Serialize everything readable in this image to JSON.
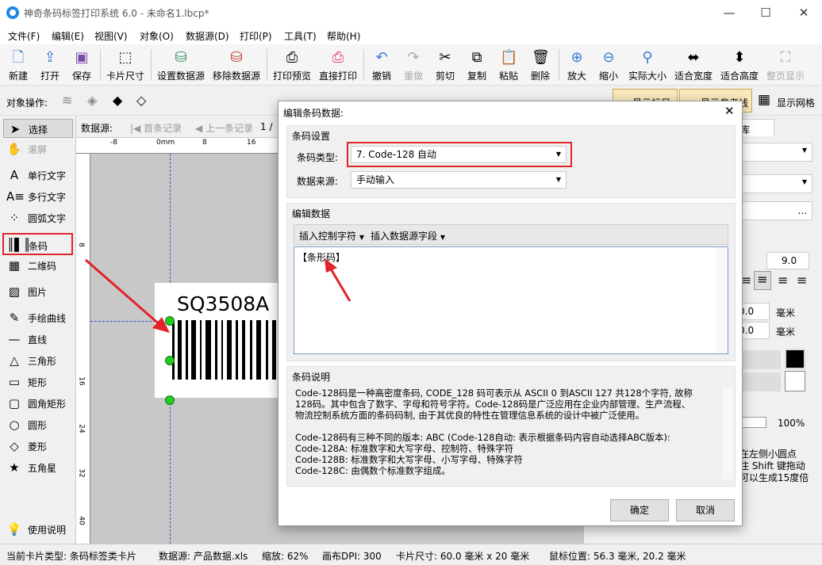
{
  "window": {
    "title": "神奇条码标签打印系统 6.0 - 未命名1.lbcp*",
    "min": "—",
    "max": "☐",
    "close": "✕"
  },
  "menu": [
    "文件(F)",
    "编辑(E)",
    "视图(V)",
    "对象(O)",
    "数据源(D)",
    "打印(P)",
    "工具(T)",
    "帮助(H)"
  ],
  "toolbar": {
    "new": "新建",
    "open": "打开",
    "save": "保存",
    "card_size": "卡片尺寸",
    "set_ds": "设置数据源",
    "remove_ds": "移除数据源",
    "preview": "打印预览",
    "print": "直接打印",
    "undo": "撤销",
    "redo": "重做",
    "cut": "剪切",
    "copy": "复制",
    "paste": "粘贴",
    "delete": "删除",
    "zoom_in": "放大",
    "zoom_out": "缩小",
    "actual": "实际大小",
    "fit_w": "适合宽度",
    "fit_h": "适合高度",
    "full_page": "整页显示"
  },
  "objbar": {
    "label": "对象操作:",
    "show_label": "显示标尺",
    "show_ref": "显示参考线",
    "show_grid": "显示网格"
  },
  "tools": [
    "选择",
    "滚屏",
    "单行文字",
    "多行文字",
    "圆弧文字",
    "条码",
    "二维码",
    "图片",
    "手绘曲线",
    "直线",
    "三角形",
    "矩形",
    "圆角矩形",
    "圆形",
    "菱形",
    "五角星",
    "使用说明"
  ],
  "nav": {
    "label": "数据源:",
    "first": "首条记录",
    "prev": "上一条记录",
    "page": "1 /"
  },
  "ruler": {
    "h": [
      "-8",
      "0mm",
      "8",
      "16"
    ],
    "v": [
      "8",
      "16",
      "24",
      "32",
      "40"
    ]
  },
  "card": {
    "text": "SQ3508A"
  },
  "rightpanel": {
    "tab": "库",
    "font_size": "9.0",
    "v1": "0.0",
    "v2": "0.0",
    "unit": "毫米",
    "percent": "100%",
    "hint1": "在左侧小圆点",
    "hint2": "住 Shift 键拖动",
    "hint3": "可以生成15度倍",
    "hint4": "。"
  },
  "status": {
    "card_type": "当前卡片类型: 条码标签类卡片",
    "ds": "数据源: 产品数据.xls",
    "zoom": "缩放: 62%",
    "dpi": "画布DPI: 300",
    "size": "卡片尺寸: 60.0 毫米 x 20 毫米",
    "mouse": "鼠标位置: 56.3 毫米, 20.2 毫米"
  },
  "dialog": {
    "title": "编辑条码数据:",
    "close": "✕",
    "barcode_settings": "条码设置",
    "type_label": "条码类型:",
    "type_value": "7. Code-128 自动",
    "source_label": "数据来源:",
    "source_value": "手动输入",
    "edit_data": "编辑数据",
    "insert_ctrl": "插入控制字符",
    "insert_field": "插入数据源字段",
    "data_value": "【条形码】",
    "desc_title": "条码说明",
    "desc": [
      "Code-128码是一种高密度条码, CODE_128 码可表示从 ASCII 0 到ASCII 127 共128个字符, 故称",
      "128码。其中包含了数字、字母和符号字符。Code-128码是广泛应用在企业内部管理、生产流程、",
      "物流控制系统方面的条码码制, 由于其优良的特性在管理信息系统的设计中被广泛使用。",
      "",
      "Code-128码有三种不同的版本: ABC (Code-128自动: 表示根据条码内容自动选择ABC版本):",
      "Code-128A: 标准数字和大写字母、控制符、特殊字符",
      "Code-128B: 标准数字和大写字母、小写字母、特殊字符",
      "Code-128C: 由偶数个标准数字组成。"
    ],
    "ok": "确定",
    "cancel": "取消"
  },
  "colors": {
    "accent_red": "#e0242a",
    "handle_green": "#22cc22"
  }
}
